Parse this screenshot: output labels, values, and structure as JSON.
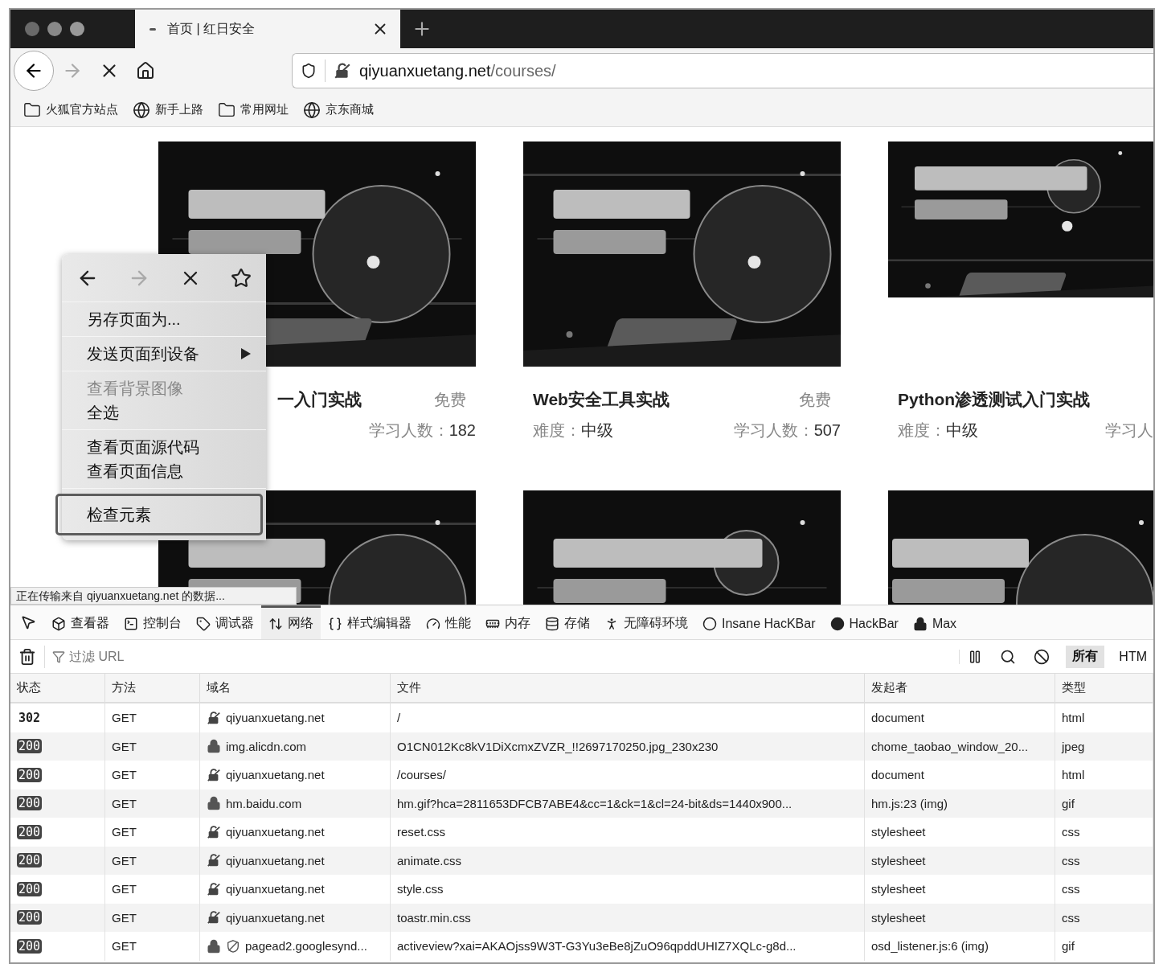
{
  "browser": {
    "tab": {
      "title": "首页 | 红日安全"
    },
    "nav": {
      "forward_disabled": true
    },
    "url": {
      "host": "qiyuanxuetang.net",
      "path": "/courses/"
    },
    "bookmarks": [
      {
        "label": "火狐官方站点",
        "kind": "folder"
      },
      {
        "label": "新手上路",
        "kind": "site"
      },
      {
        "label": "常用网址",
        "kind": "folder"
      },
      {
        "label": "京东商城",
        "kind": "site"
      }
    ]
  },
  "courses": [
    {
      "title": "一入门实战",
      "price": "免费",
      "learners_label": "学习人数：",
      "learners": "182"
    },
    {
      "title": "Web安全工具实战",
      "price": "免费",
      "difficulty_label": "难度：",
      "difficulty": "中级",
      "learners_label": "学习人数：",
      "learners": "507"
    },
    {
      "title": "Python渗透测试入门实战",
      "difficulty_label": "难度：",
      "difficulty": "中级",
      "learners_label": "学习人"
    }
  ],
  "context_menu": {
    "nav": {
      "forward_disabled": true
    },
    "groups": [
      {
        "items": [
          {
            "label": "另存页面为...",
            "disabled": false,
            "submenu": false,
            "selected": false
          }
        ]
      },
      {
        "items": [
          {
            "label": "发送页面到设备",
            "disabled": false,
            "submenu": true,
            "selected": false
          }
        ]
      },
      {
        "items": [
          {
            "label": "查看背景图像",
            "disabled": true,
            "submenu": false,
            "selected": false
          },
          {
            "label": "全选",
            "disabled": false,
            "submenu": false,
            "selected": false
          }
        ]
      },
      {
        "items": [
          {
            "label": "查看页面源代码",
            "disabled": false,
            "submenu": false,
            "selected": false
          },
          {
            "label": "查看页面信息",
            "disabled": false,
            "submenu": false,
            "selected": false
          }
        ]
      },
      {
        "items": [
          {
            "label": "检查元素",
            "disabled": false,
            "submenu": false,
            "selected": true
          }
        ]
      }
    ]
  },
  "status_text": "正在传输来自 qiyuanxuetang.net 的数据...",
  "devtools": {
    "tabs": [
      {
        "label": "查看器",
        "selected": false
      },
      {
        "label": "控制台",
        "selected": false
      },
      {
        "label": "调试器",
        "selected": false
      },
      {
        "label": "网络",
        "selected": true
      },
      {
        "label": "样式编辑器",
        "selected": false
      },
      {
        "label": "性能",
        "selected": false
      },
      {
        "label": "内存",
        "selected": false
      },
      {
        "label": "存储",
        "selected": false
      },
      {
        "label": "无障碍环境",
        "selected": false
      },
      {
        "label": "Insane HacKBar",
        "selected": false
      },
      {
        "label": "HackBar",
        "selected": false
      },
      {
        "label": "Max",
        "selected": false
      }
    ],
    "filter": {
      "placeholder": "过滤 URL"
    },
    "type_filters": [
      {
        "label": "所有",
        "selected": true
      },
      {
        "label": "HTM",
        "selected": false
      }
    ],
    "table": {
      "columns": [
        "状态",
        "方法",
        "域名",
        "文件",
        "发起者",
        "类型"
      ],
      "rows": [
        {
          "status": "302",
          "status_badge": false,
          "method": "GET",
          "kind": "insecure",
          "domain": "qiyuanxuetang.net",
          "file": "/",
          "initiator": "document",
          "type": "html"
        },
        {
          "status": "200",
          "status_badge": true,
          "method": "GET",
          "kind": "secure",
          "domain": "img.alicdn.com",
          "file": "O1CN012Kc8kV1DiXcmxZVZR_!!2697170250.jpg_230x230",
          "initiator": "chome_taobao_window_20...",
          "type": "jpeg"
        },
        {
          "status": "200",
          "status_badge": true,
          "method": "GET",
          "kind": "insecure",
          "domain": "qiyuanxuetang.net",
          "file": "/courses/",
          "initiator": "document",
          "type": "html"
        },
        {
          "status": "200",
          "status_badge": true,
          "method": "GET",
          "kind": "secure",
          "domain": "hm.baidu.com",
          "file": "hm.gif?hca=2811653DFCB7ABE4&cc=1&ck=1&cl=24-bit&ds=1440x900...",
          "initiator": "hm.js:23 (img)",
          "type": "gif"
        },
        {
          "status": "200",
          "status_badge": true,
          "method": "GET",
          "kind": "insecure",
          "domain": "qiyuanxuetang.net",
          "file": "reset.css",
          "initiator": "stylesheet",
          "type": "css"
        },
        {
          "status": "200",
          "status_badge": true,
          "method": "GET",
          "kind": "insecure",
          "domain": "qiyuanxuetang.net",
          "file": "animate.css",
          "initiator": "stylesheet",
          "type": "css"
        },
        {
          "status": "200",
          "status_badge": true,
          "method": "GET",
          "kind": "insecure",
          "domain": "qiyuanxuetang.net",
          "file": "style.css",
          "initiator": "stylesheet",
          "type": "css"
        },
        {
          "status": "200",
          "status_badge": true,
          "method": "GET",
          "kind": "insecure",
          "domain": "qiyuanxuetang.net",
          "file": "toastr.min.css",
          "initiator": "stylesheet",
          "type": "css"
        },
        {
          "status": "200",
          "status_badge": true,
          "method": "GET",
          "kind": "tracker",
          "domain": "pagead2.googlesynd...",
          "file": "activeview?xai=AKAOjss9W3T-G3Yu3eBe8jZuO96qpddUHIZ7XQLc-g8d...",
          "initiator": "osd_listener.js:6 (img)",
          "type": "gif"
        }
      ]
    }
  }
}
